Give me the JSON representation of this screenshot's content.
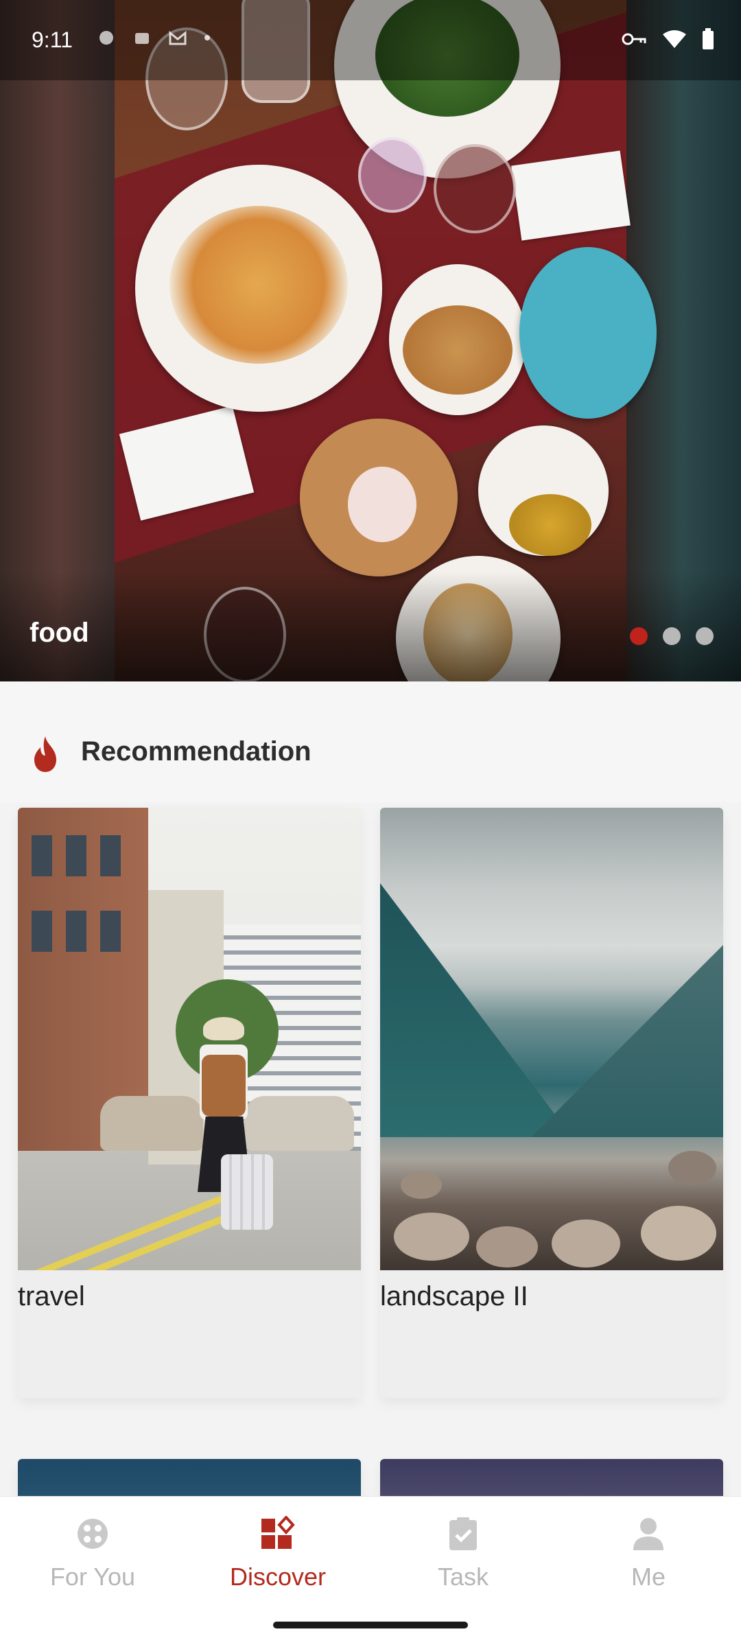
{
  "status_bar": {
    "time": "9:11"
  },
  "hero": {
    "title": "food",
    "carousel": {
      "total": 3,
      "active_index": 0
    },
    "colors": {
      "active_dot": "#c0221c",
      "inactive_dot": "#b8b8b8"
    }
  },
  "recommendation": {
    "title": "Recommendation",
    "icon": "flame-icon",
    "cards": [
      {
        "label": "travel"
      },
      {
        "label": "landscape II"
      }
    ]
  },
  "bottom_nav": {
    "items": [
      {
        "label": "For You",
        "icon": "film-reel-icon"
      },
      {
        "label": "Discover",
        "icon": "grid-diamond-icon",
        "active": true
      },
      {
        "label": "Task",
        "icon": "clipboard-check-icon"
      },
      {
        "label": "Me",
        "icon": "person-icon"
      }
    ],
    "active_color": "#b32a1e",
    "inactive_color": "#b7b7b7"
  }
}
